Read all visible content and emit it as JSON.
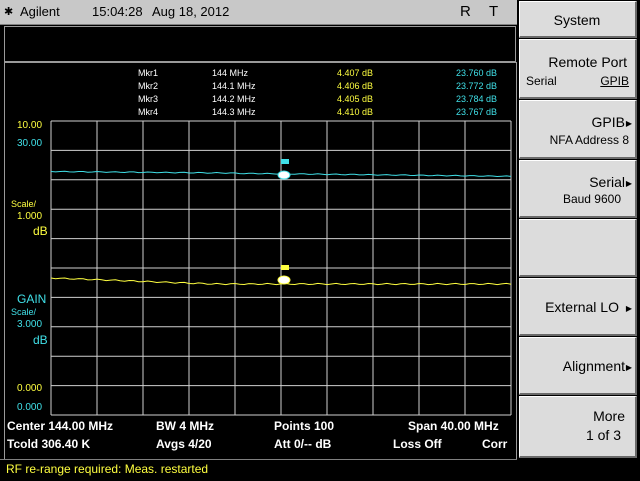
{
  "header": {
    "brand": "Agilent",
    "time": "15:04:28",
    "date": "Aug 18, 2012",
    "indicator_r": "R",
    "indicator_t": "T"
  },
  "markers": [
    {
      "name": "Mkr1",
      "freq": "144 MHz",
      "gain": "4.407 dB",
      "tcold": "23.760 dB"
    },
    {
      "name": "Mkr2",
      "freq": "144.1 MHz",
      "gain": "4.406 dB",
      "tcold": "23.772 dB"
    },
    {
      "name": "Mkr3",
      "freq": "144.2 MHz",
      "gain": "4.405 dB",
      "tcold": "23.784 dB"
    },
    {
      "name": "Mkr4",
      "freq": "144.3 MHz",
      "gain": "4.410 dB",
      "tcold": "23.767 dB"
    }
  ],
  "left_labels": {
    "top_ref_upper": "10.00",
    "top_ref_lower": "30.00",
    "scale1_a": "Scale/",
    "scale1_b": "1.000",
    "scale1_unit": "dB",
    "gain": "GAIN",
    "scale2_a": "Scale/",
    "scale2_b": "3.000",
    "scale2_unit": "dB",
    "bottom_ref_upper": "0.000",
    "bottom_ref_lower": "0.000"
  },
  "footer": {
    "center": "Center 144.00 MHz",
    "bw": "BW 4 MHz",
    "points": "Points 100",
    "span": "Span 40.00 MHz",
    "tcold": "Tcold 306.40 K",
    "avgs": "Avgs 4/20",
    "att": "Att 0/-- dB",
    "loss": "Loss Off",
    "corr": "Corr"
  },
  "status_message": "RF re-range required: Meas. restarted",
  "softkeys": {
    "title": "System",
    "items": [
      {
        "label": "Remote Port",
        "sub_left": "Serial",
        "sub_right": "GPIB"
      },
      {
        "label": "GPIB",
        "sub": "NFA Address 8"
      },
      {
        "label": "Serial",
        "sub": "Baud 9600"
      },
      {
        "label": ""
      },
      {
        "label": "External LO"
      },
      {
        "label": "Alignment"
      },
      {
        "label": "More",
        "sub": "1 of 3"
      }
    ]
  },
  "colors": {
    "tcold_trace": "#40e0e8",
    "gain_trace": "#ffff40",
    "grid": "#d0d0d0"
  }
}
